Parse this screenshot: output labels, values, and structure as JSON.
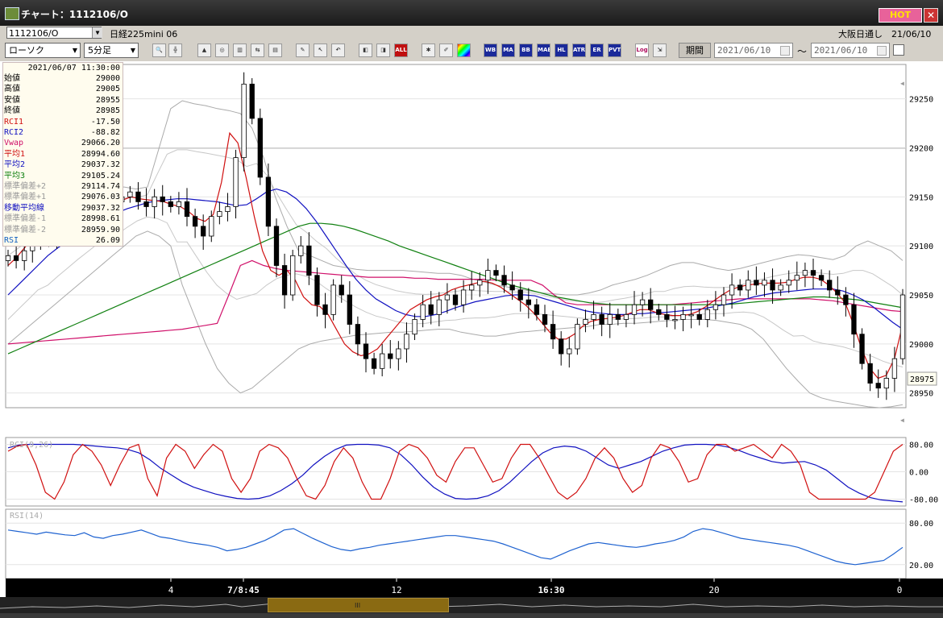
{
  "window": {
    "title": "チャート：1112106/O",
    "hot_label": "HOT",
    "close_label": "✕"
  },
  "symbol": {
    "code": "1112106/O",
    "name": "日経225mini 06",
    "market": "大阪日通し　21/06/10"
  },
  "toolbar": {
    "chart_type": "ローソク",
    "interval": "5分足",
    "buttons": [
      "WB",
      "MA",
      "BB",
      "MAE",
      "HL",
      "ATR",
      "ER",
      "PVT",
      "Log"
    ],
    "period_label": "期間",
    "date_from": "2021/06/10",
    "date_to": "2021/06/10",
    "tilde": "～"
  },
  "info_panel": {
    "timestamp": "2021/06/07 11:30:00",
    "rows": [
      {
        "label": "始値",
        "value": "29000",
        "color": "#000000"
      },
      {
        "label": "高値",
        "value": "29005",
        "color": "#000000"
      },
      {
        "label": "安値",
        "value": "28955",
        "color": "#000000"
      },
      {
        "label": "終値",
        "value": "28985",
        "color": "#000000"
      },
      {
        "label": "RCI1",
        "value": "-17.50",
        "color": "#d01010"
      },
      {
        "label": "RCI2",
        "value": "-88.82",
        "color": "#1010c0"
      },
      {
        "label": "Vwap",
        "value": "29066.20",
        "color": "#d0106a"
      },
      {
        "label": "平均1",
        "value": "28994.60",
        "color": "#d01010"
      },
      {
        "label": "平均2",
        "value": "29037.32",
        "color": "#1010c0"
      },
      {
        "label": "平均3",
        "value": "29105.24",
        "color": "#108010"
      },
      {
        "label": "標準偏差+2",
        "value": "29114.74",
        "color": "#999999"
      },
      {
        "label": "標準偏差+1",
        "value": "29076.03",
        "color": "#999999"
      },
      {
        "label": "移動平均線",
        "value": "29037.32",
        "color": "#1010c0"
      },
      {
        "label": "標準偏差-1",
        "value": "28998.61",
        "color": "#999999"
      },
      {
        "label": "標準偏差-2",
        "value": "28959.90",
        "color": "#999999"
      },
      {
        "label": "RSI",
        "value": "26.09",
        "color": "#1060c0"
      }
    ]
  },
  "price_axis": {
    "ticks": [
      "29250",
      "29200",
      "29150",
      "29100",
      "29050",
      "29000",
      "28950"
    ],
    "tick_values": [
      29250,
      29200,
      29150,
      29100,
      29050,
      29000,
      28950
    ],
    "range": [
      28935,
      29285
    ],
    "current_price": "28975",
    "current_value": 28975
  },
  "rci_panel": {
    "title": "RCI(9,26)",
    "ticks": [
      "80.00",
      "0.00",
      "-80.00"
    ],
    "tick_values": [
      80,
      0,
      -80
    ],
    "range": [
      -100,
      100
    ]
  },
  "rsi_panel": {
    "title": "RSI(14)",
    "ticks": [
      "80.00",
      "20.00"
    ],
    "tick_values": [
      80,
      20
    ],
    "range": [
      0,
      100
    ]
  },
  "time_axis": {
    "labels": [
      "4",
      "7/8:45",
      "12",
      "16:30",
      "20",
      "0"
    ],
    "bold": [
      false,
      true,
      false,
      true,
      false,
      false
    ]
  },
  "scrollbar": {
    "grip": "III"
  },
  "chart_data": {
    "type": "candlestick",
    "instrument": "日経225mini 06",
    "interval": "5分足",
    "ylim": [
      28935,
      29285
    ],
    "price": [
      29090,
      29085,
      29095,
      29110,
      29120,
      29105,
      29125,
      29130,
      29120,
      29125,
      29140,
      29135,
      29130,
      29145,
      29150,
      29155,
      29145,
      29140,
      29150,
      29145,
      29140,
      29145,
      29130,
      29120,
      29110,
      29130,
      29135,
      29140,
      29190,
      29265,
      29230,
      29170,
      29120,
      29080,
      29050,
      29090,
      29100,
      29070,
      29040,
      29030,
      29060,
      29050,
      29020,
      29000,
      28985,
      28975,
      28990,
      28985,
      28995,
      29010,
      29025,
      29040,
      29030,
      29045,
      29050,
      29040,
      29055,
      29060,
      29065,
      29075,
      29070,
      29060,
      29055,
      29045,
      29040,
      29030,
      29020,
      29005,
      28990,
      28995,
      29020,
      29025,
      29030,
      29020,
      29030,
      29025,
      29030,
      29040,
      29045,
      29035,
      29030,
      29025,
      29025,
      29030,
      29030,
      29025,
      29035,
      29040,
      29050,
      29060,
      29055,
      29065,
      29060,
      29065,
      29055,
      29060,
      29065,
      29070,
      29075,
      29070,
      29065,
      29055,
      29050,
      29040,
      29010,
      28980,
      28960,
      28955,
      28965,
      28985,
      29050
    ],
    "ma1": [
      29080,
      29088,
      29098,
      29108,
      29115,
      29118,
      29122,
      29125,
      29127,
      29130,
      29135,
      29137,
      29140,
      29143,
      29147,
      29150,
      29148,
      29147,
      29146,
      29145,
      29142,
      29140,
      29135,
      29128,
      29125,
      29132,
      29165,
      29215,
      29205,
      29170,
      29130,
      29095,
      29075,
      29070,
      29075,
      29065,
      29048,
      29040,
      29038,
      29030,
      29015,
      29000,
      28992,
      28988,
      28990,
      28995,
      29005,
      29015,
      29025,
      29035,
      29040,
      29045,
      29048,
      29050,
      29055,
      29058,
      29060,
      29062,
      29064,
      29062,
      29058,
      29052,
      29046,
      29040,
      29032,
      29022,
      29012,
      29005,
      29005,
      29010,
      29018,
      29023,
      29025,
      29026,
      29027,
      29029,
      29032,
      29035,
      29035,
      29032,
      29030,
      29029,
      29029,
      29030,
      29033,
      29038,
      29044,
      29050,
      29055,
      29058,
      29060,
      29061,
      29062,
      29062,
      29062,
      29063,
      29066,
      29068,
      29068,
      29066,
      29060,
      29052,
      29042,
      29020,
      28995,
      28975,
      28965,
      28968,
      28985,
      29020
    ],
    "ma2": [
      29050,
      29060,
      29070,
      29080,
      29090,
      29098,
      29105,
      29112,
      29118,
      29124,
      29130,
      29134,
      29138,
      29141,
      29144,
      29146,
      29147,
      29148,
      29148,
      29147,
      29146,
      29145,
      29143,
      29141,
      29142,
      29148,
      29155,
      29158,
      29155,
      29148,
      29138,
      29125,
      29110,
      29095,
      29080,
      29066,
      29055,
      29046,
      29040,
      29034,
      29030,
      29028,
      29028,
      29030,
      29033,
      29037,
      29040,
      29043,
      29045,
      29047,
      29049,
      29050,
      29050,
      29049,
      29046,
      29043,
      29040,
      29037,
      29034,
      29032,
      29031,
      29030,
      29030,
      29031,
      29031,
      29032,
      29032,
      29033,
      29034,
      29035,
      29036,
      29038,
      29040,
      29042,
      29045,
      29048,
      29050,
      29052,
      29053,
      29054,
      29055,
      29056,
      29056,
      29056,
      29054,
      29050,
      29045,
      29038,
      29030,
      29022,
      29015
    ],
    "ma3": [
      28990,
      28995,
      29000,
      29005,
      29010,
      29015,
      29020,
      29025,
      29030,
      29035,
      29040,
      29045,
      29050,
      29055,
      29060,
      29065,
      29070,
      29075,
      29080,
      29085,
      29090,
      29095,
      29100,
      29105,
      29110,
      29115,
      29120,
      29123,
      29123,
      29122,
      29120,
      29117,
      29113,
      29109,
      29105,
      29100,
      29096,
      29092,
      29088,
      29084,
      29080,
      29076,
      29072,
      29068,
      29064,
      29060,
      29057,
      29054,
      29051,
      29048,
      29046,
      29044,
      29042,
      29041,
      29040,
      29040,
      29040,
      29040,
      29040,
      29040,
      29040,
      29040,
      29040,
      29040,
      29040,
      29041,
      29042,
      29043,
      29044,
      29045,
      29046,
      29047,
      29048,
      29048,
      29047,
      29046,
      29045,
      29043,
      29041,
      29039,
      29037
    ],
    "vwap": [
      29000,
      29001,
      29002,
      29003,
      29004,
      29005,
      29006,
      29007,
      29008,
      29009,
      29010,
      29011,
      29012,
      29013,
      29014,
      29015,
      29017,
      29019,
      29021,
      29050,
      29080,
      29085,
      29080,
      29077,
      29075,
      29074,
      29073,
      29072,
      29071,
      29070,
      29069,
      29068,
      29068,
      29068,
      29068,
      29067,
      29067,
      29066,
      29066,
      29066,
      29066,
      29066,
      29065,
      29065,
      29065,
      29065,
      29060,
      29050,
      29042,
      29040,
      29040,
      29040,
      29040,
      29040,
      29040,
      29040,
      29040,
      29040,
      29041,
      29042,
      29043,
      29044,
      29045,
      29046,
      29046,
      29046,
      29046,
      29046,
      29046,
      29046,
      29045,
      29044,
      29042,
      29040,
      29038,
      29036,
      29034,
      29033
    ],
    "bb_upper2": [
      29130,
      29135,
      29140,
      29145,
      29150,
      29153,
      29155,
      29158,
      29160,
      29160,
      29160,
      29158,
      29160,
      29200,
      29240,
      29248,
      29245,
      29243,
      29240,
      29238,
      29235,
      29220,
      29190,
      29150,
      29120,
      29095,
      29090,
      29085,
      29080,
      29078,
      29076,
      29075,
      29075,
      29075,
      29075,
      29074,
      29073,
      29072,
      29072,
      29070,
      29066,
      29063,
      29060,
      29058,
      29056,
      29054,
      29052,
      29051,
      29050,
      29050,
      29052,
      29055,
      29060,
      29063,
      29066,
      29070,
      29075,
      29080,
      29083,
      29083,
      29080,
      29077,
      29075,
      29077,
      29080,
      29083,
      29086,
      29089,
      29091,
      29090,
      29088,
      29086,
      29090,
      29100,
      29105,
      29100,
      29095,
      29085
    ],
    "bb_lower2": [
      29000,
      29010,
      29020,
      29030,
      29040,
      29050,
      29060,
      29070,
      29080,
      29090,
      29100,
      29110,
      29115,
      29110,
      29100,
      29060,
      29030,
      29000,
      28975,
      28960,
      28950,
      28955,
      28965,
      28975,
      28985,
      28995,
      29000,
      29003,
      29005,
      29007,
      29009,
      29010,
      29011,
      29012,
      29012,
      29013,
      29014,
      29015,
      29015,
      29012,
      29010,
      29008,
      29008,
      29010,
      29012,
      29013,
      29014,
      29015,
      29016,
      29017,
      29018,
      29020,
      29020,
      29021,
      29021,
      29022,
      29023,
      29024,
      29025,
      29025,
      29025,
      29024,
      29022,
      29020,
      29015,
      29005,
      28990,
      28975,
      28962,
      28950,
      28945,
      28942,
      28940,
      28938,
      28936,
      28935,
      28936,
      28938
    ],
    "rci1": [
      60,
      75,
      80,
      20,
      -60,
      -80,
      -30,
      50,
      80,
      60,
      20,
      -40,
      20,
      70,
      80,
      -20,
      -70,
      40,
      80,
      60,
      10,
      50,
      80,
      60,
      -20,
      -60,
      -20,
      60,
      80,
      70,
      40,
      -20,
      -70,
      -80,
      -40,
      30,
      70,
      40,
      -30,
      -80,
      -80,
      -20,
      60,
      80,
      70,
      40,
      -10,
      -30,
      30,
      70,
      70,
      20,
      -30,
      -20,
      40,
      80,
      80,
      40,
      -10,
      -60,
      -80,
      -60,
      -20,
      40,
      70,
      40,
      -20,
      -60,
      -40,
      40,
      80,
      70,
      30,
      -30,
      -20,
      50,
      80,
      80,
      60,
      70,
      80,
      60,
      40,
      80,
      60,
      20,
      -60,
      -80,
      -80,
      -80,
      -80,
      -80,
      -80,
      -60,
      0,
      60,
      80
    ],
    "rci2": [
      70,
      78,
      80,
      80,
      80,
      80,
      80,
      78,
      75,
      72,
      70,
      65,
      55,
      35,
      10,
      -10,
      -30,
      -45,
      -55,
      -65,
      -72,
      -78,
      -80,
      -78,
      -70,
      -55,
      -35,
      -10,
      20,
      45,
      65,
      78,
      80,
      80,
      78,
      70,
      50,
      20,
      -15,
      -45,
      -65,
      -78,
      -80,
      -78,
      -70,
      -55,
      -30,
      0,
      30,
      55,
      70,
      75,
      72,
      60,
      40,
      20,
      10,
      20,
      30,
      45,
      60,
      70,
      78,
      80,
      80,
      78,
      72,
      62,
      50,
      40,
      30,
      25,
      28,
      30,
      20,
      5,
      -20,
      -45,
      -62,
      -75,
      -82,
      -85,
      -88
    ],
    "rsi": [
      70,
      68,
      66,
      64,
      67,
      65,
      63,
      62,
      66,
      60,
      58,
      62,
      64,
      67,
      70,
      65,
      60,
      58,
      55,
      52,
      50,
      48,
      45,
      40,
      42,
      45,
      50,
      55,
      62,
      70,
      72,
      65,
      58,
      52,
      46,
      42,
      40,
      43,
      45,
      48,
      50,
      52,
      54,
      56,
      58,
      60,
      62,
      62,
      60,
      58,
      56,
      54,
      50,
      45,
      40,
      35,
      30,
      28,
      34,
      40,
      45,
      50,
      52,
      50,
      48,
      46,
      45,
      47,
      50,
      52,
      55,
      60,
      68,
      72,
      70,
      66,
      62,
      58,
      56,
      54,
      52,
      50,
      48,
      45,
      40,
      35,
      30,
      25,
      22,
      20,
      22,
      24,
      26,
      35,
      45
    ]
  }
}
